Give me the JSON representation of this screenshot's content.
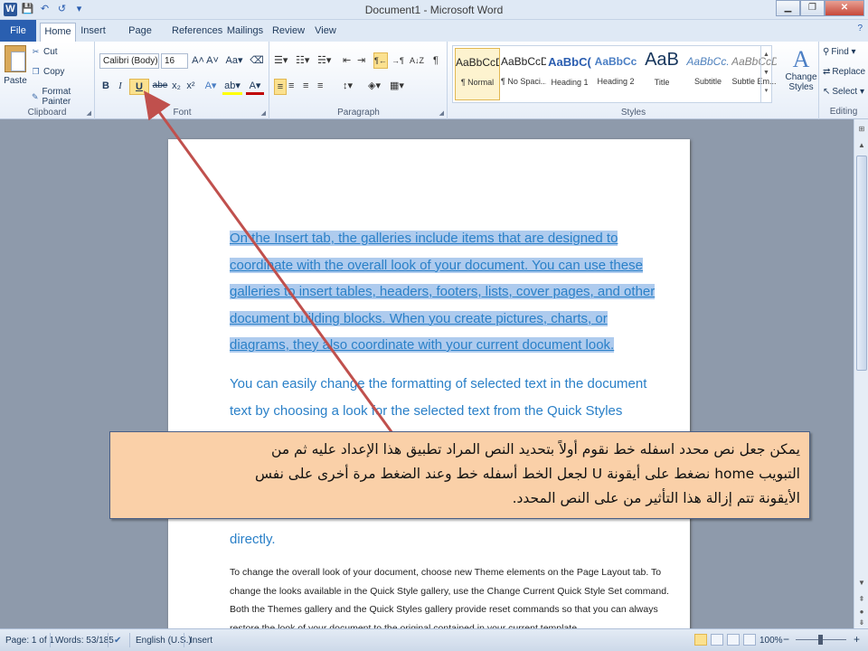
{
  "window": {
    "title": "Document1 - Microsoft Word",
    "minimize": "▁",
    "restore": "❐",
    "close": "✕",
    "help": "?"
  },
  "qat": {
    "app_icon": "W",
    "save": "💾",
    "undo": "↶",
    "redo": "↺",
    "customize": "▾"
  },
  "tabs": [
    "File",
    "Home",
    "Insert",
    "Page Layout",
    "References",
    "Mailings",
    "Review",
    "View"
  ],
  "clipboard": {
    "paste": "Paste",
    "cut": "Cut",
    "copy": "Copy",
    "format_painter": "Format Painter",
    "label": "Clipboard"
  },
  "font": {
    "name": "Calibri (Body)",
    "size": "16",
    "label": "Font",
    "bold": "B",
    "italic": "I",
    "underline": "U",
    "strike": "abe",
    "sub": "x₂",
    "sup": "x²",
    "grow": "A˄",
    "shrink": "A˅",
    "case": "Aa▾",
    "clear": "⌫",
    "effects": "A▾",
    "highlight": "ab▾",
    "color": "A▾"
  },
  "paragraph": {
    "label": "Paragraph",
    "bullets": "☰▾",
    "numbering": "☷▾",
    "multilevel": "☵▾",
    "dec_indent": "⇤",
    "inc_indent": "⇥",
    "rtl_dir": "¶←",
    "ltr_dir": "→¶",
    "sort": "A↓Z",
    "pilcrow": "¶",
    "align_left": "≡",
    "center": "≡",
    "align_right": "≡",
    "justify": "≡",
    "line_spacing": "↕▾",
    "shading": "◈▾",
    "borders": "▦▾"
  },
  "styles": {
    "label": "Styles",
    "items": [
      {
        "sample": "AaBbCcDc",
        "name": "¶ Normal"
      },
      {
        "sample": "AaBbCcDc",
        "name": "¶ No Spaci..."
      },
      {
        "sample": "AaBbC(",
        "name": "Heading 1"
      },
      {
        "sample": "AaBbCc",
        "name": "Heading 2"
      },
      {
        "sample": "AaB",
        "name": "Title"
      },
      {
        "sample": "AaBbCc.",
        "name": "Subtitle"
      },
      {
        "sample": "AaBbCcDc",
        "name": "Subtle Em..."
      }
    ],
    "change_styles": "Change Styles",
    "change_icon": "A"
  },
  "editing": {
    "find": "Find ▾",
    "replace": "Replace",
    "select": "Select ▾",
    "label": "Editing"
  },
  "document": {
    "para1_lines": [
      "On the Insert tab, the galleries include items that are designed to",
      "coordinate with the overall look of your document. You can use these",
      "galleries to insert tables, headers, footers, lists, cover pages, and other",
      "document building blocks. When you create pictures, charts, or",
      "diagrams, they also coordinate with your current document look."
    ],
    "para2_lines": [
      "You can easily change the formatting of selected text in the document",
      "text by choosing a look for the selected text from the Quick Styles"
    ],
    "para2_tail": "directly.",
    "para3_lines": [
      "To change the overall look of your document, choose new Theme elements on the Page Layout tab. To",
      "change the looks available in the Quick Style gallery, use the Change Current Quick Style Set command.",
      "Both the Themes gallery and the Quick Styles gallery provide reset commands so that you can always",
      "restore the look of your document to the original contained in your current template."
    ]
  },
  "callout": {
    "lines": [
      "يمكن جعل نص محدد اسفله خط نقوم أولاً بتحديد النص المراد تطبيق هذا الإعداد عليه ثم من",
      "التبويب home نضغط على أيقونة U لجعل الخط أسفله خط وعند الضغط مرة أخرى على نفس",
      "الأيقونة تتم إزالة هذا التأثير من على النص المحدد."
    ]
  },
  "status": {
    "page": "Page: 1 of 1",
    "words": "Words: 53/185",
    "language": "English (U.S.)",
    "mode": "Insert",
    "zoom": "100%",
    "zoom_minus": "−",
    "zoom_plus": "+"
  },
  "colors": {
    "accent": "#2b579a",
    "selection": "#aecbee",
    "callout_bg": "#fad0a8",
    "arrow": "#c0504d",
    "body_text": "#2a80c8"
  }
}
